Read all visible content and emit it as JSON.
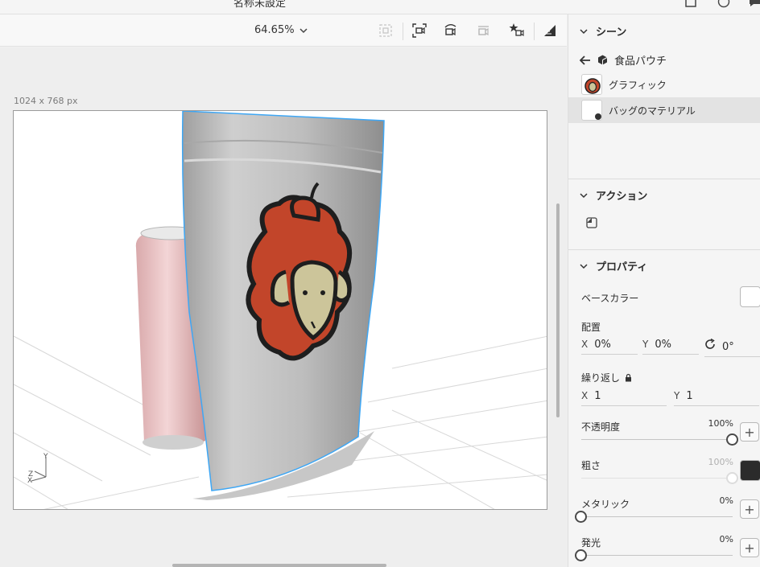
{
  "window": {
    "title": "名称未設定"
  },
  "toolbar": {
    "zoom": "64.65%",
    "tools": [
      "select-frame-icon",
      "camera-frame-icon",
      "orbit-camera-icon",
      "pan-camera-icon",
      "bookmark-camera-icon",
      "render-icon"
    ]
  },
  "canvas": {
    "size_label": "1024 x 768 px",
    "axis_y": "Y",
    "axis_z": "Z",
    "axis_x": "X"
  },
  "panel": {
    "scene": {
      "title": "シーン",
      "back_label": "食品パウチ",
      "layers": [
        {
          "label": "グラフィック",
          "selected": false
        },
        {
          "label": "バッグのマテリアル",
          "selected": true
        }
      ]
    },
    "actions": {
      "title": "アクション"
    },
    "properties": {
      "title": "プロパティ",
      "base_color_label": "ベースカラー",
      "base_color": "#ffffff",
      "placement_label": "配置",
      "x_label": "X",
      "x_value": "0%",
      "y_label": "Y",
      "y_value": "0%",
      "rotation_value": "0°",
      "repeat_label": "繰り返し",
      "repeat_x_label": "X",
      "repeat_x_value": "1",
      "repeat_y_label": "Y",
      "repeat_y_value": "1",
      "opacity_label": "不透明度",
      "opacity_value": "100%",
      "opacity_level": 1.0,
      "roughness_label": "粗さ",
      "roughness_value": "100%",
      "roughness_level": 1.0,
      "roughness_color": "#2b2b2b",
      "metallic_label": "メタリック",
      "metallic_value": "0%",
      "metallic_level": 0.0,
      "emission_label": "発光",
      "emission_value": "0%",
      "emission_level": 0.0
    }
  },
  "colors": {
    "selection_outline": "#3ea7f5",
    "pouch": "#c8c8c8",
    "can": "#e8c3c3",
    "logo_red": "#c2452a",
    "logo_face": "#ccc59a"
  }
}
